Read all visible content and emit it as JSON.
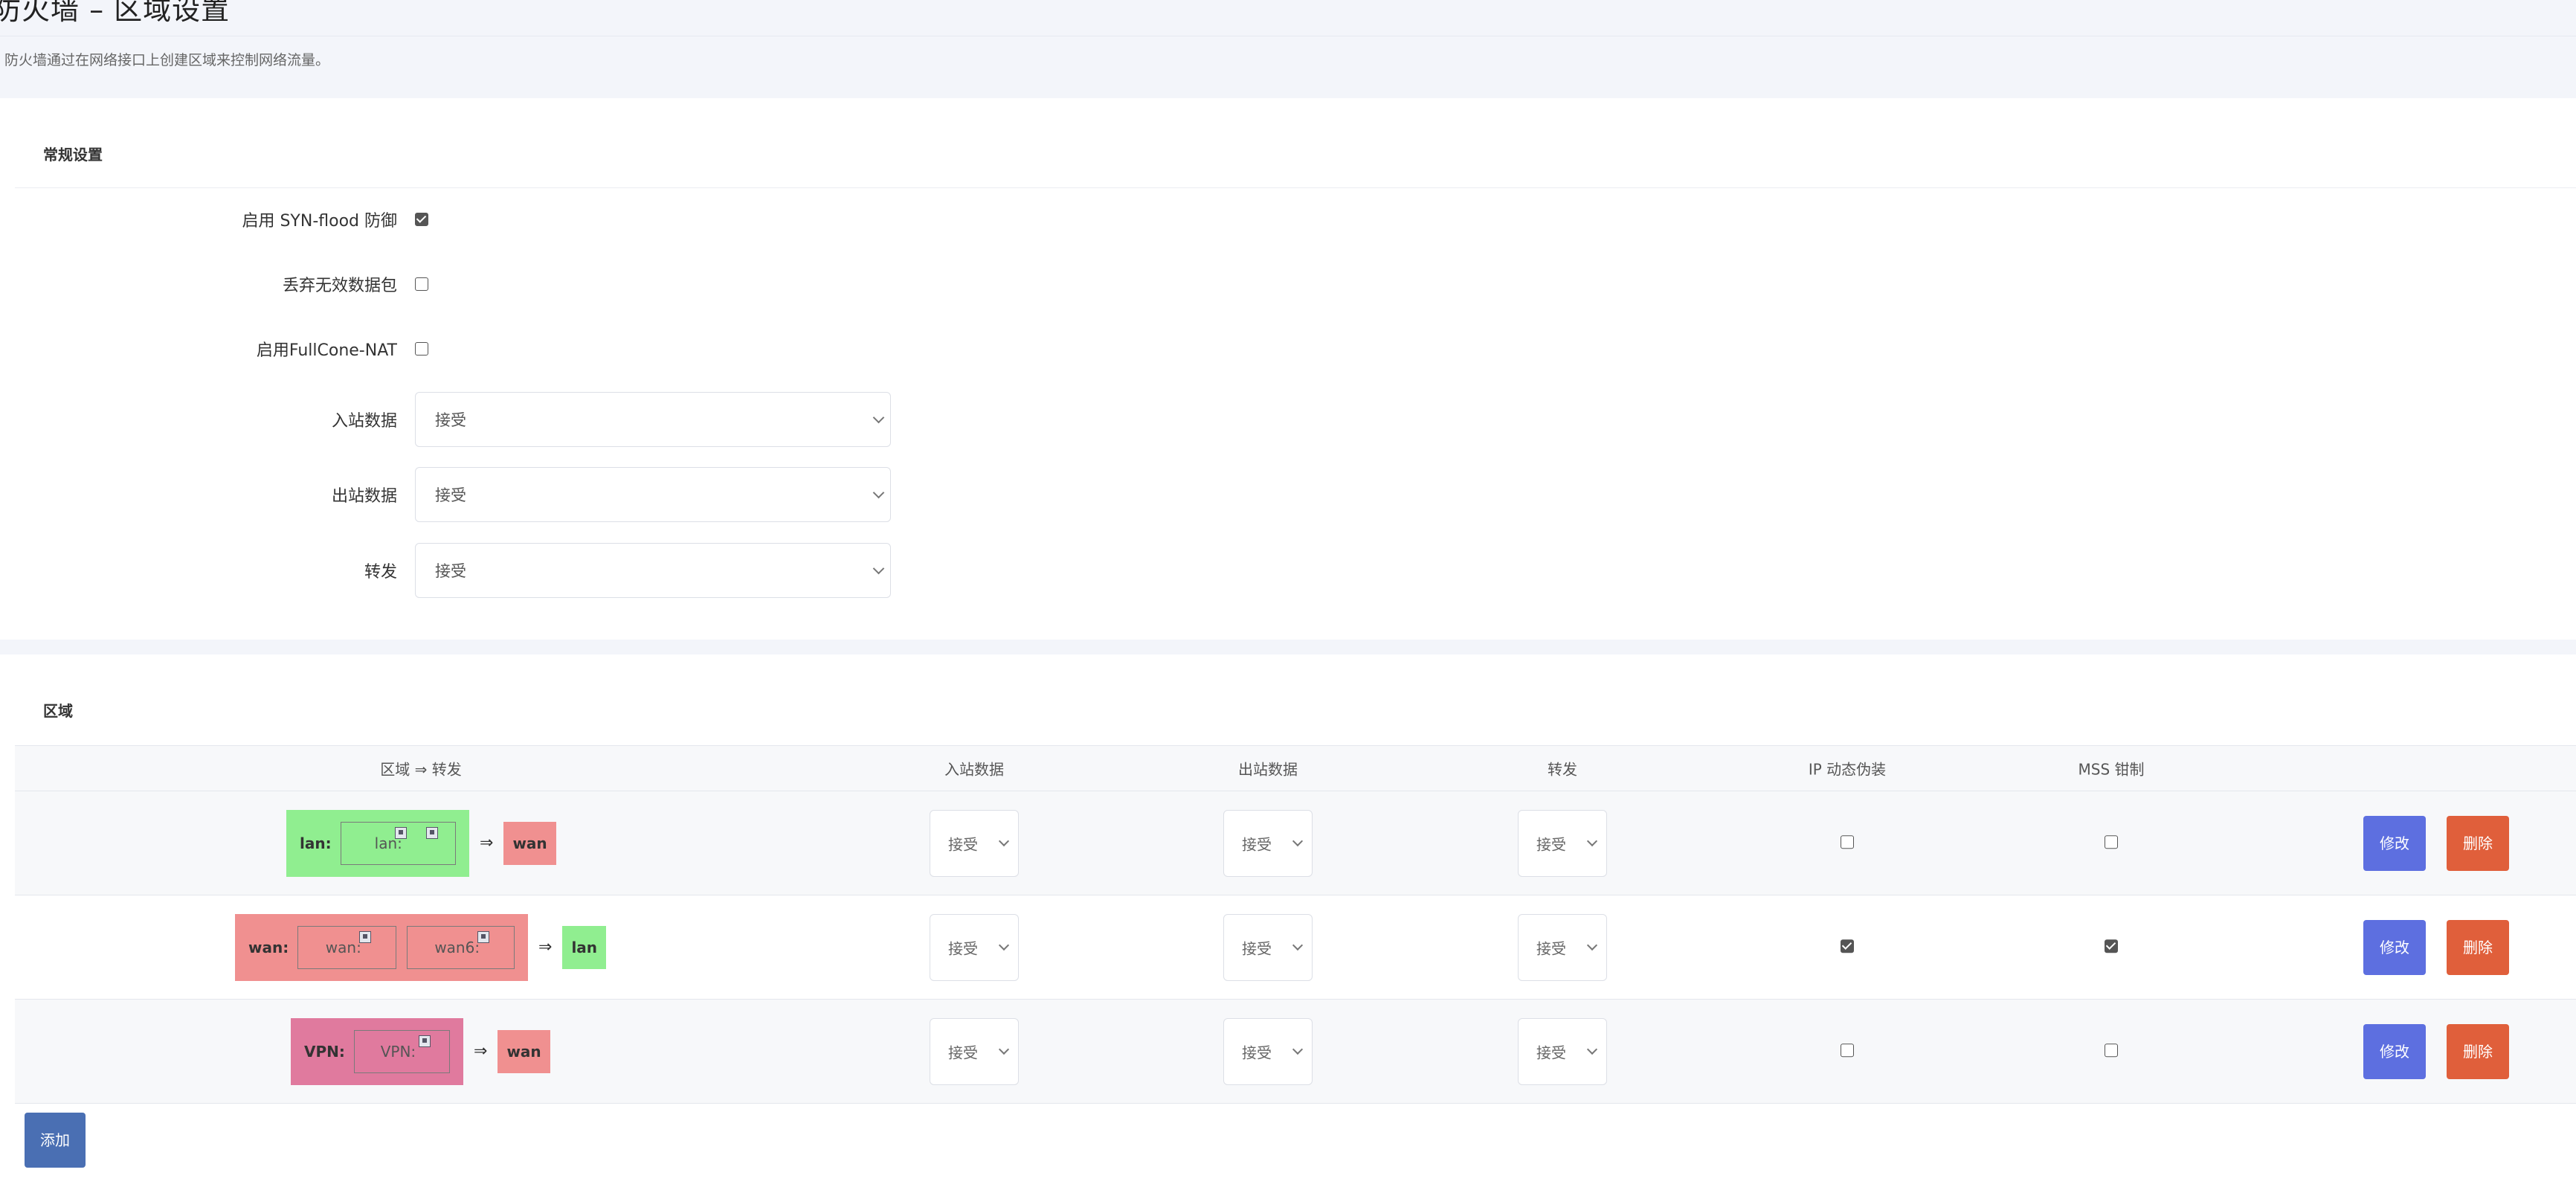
{
  "header": {
    "title": "防火墙 – 区域设置",
    "description": "防火墙通过在网络接口上创建区域来控制网络流量。"
  },
  "general": {
    "title": "常规设置",
    "syn_flood": {
      "label": "启用 SYN-flood 防御",
      "checked": true
    },
    "drop_invalid": {
      "label": "丢弃无效数据包",
      "checked": false
    },
    "fullcone": {
      "label": "启用FullCone-NAT",
      "checked": false
    },
    "input": {
      "label": "入站数据",
      "value": "接受"
    },
    "output": {
      "label": "出站数据",
      "value": "接受"
    },
    "forward": {
      "label": "转发",
      "value": "接受"
    }
  },
  "zones": {
    "title": "区域",
    "columns": {
      "zone": "区域 ⇒ 转发",
      "input": "入站数据",
      "output": "出站数据",
      "forward": "转发",
      "masq": "IP 动态伪装",
      "mss": "MSS 钳制"
    },
    "arrow": "⇒",
    "rows": [
      {
        "name": "lan:",
        "zone_color": "#90ee90",
        "interfaces": [
          "lan:"
        ],
        "dest": "wan",
        "dest_color": "#f09090",
        "input": "接受",
        "output": "接受",
        "forward": "接受",
        "masq": false,
        "mss": false
      },
      {
        "name": "wan:",
        "zone_color": "#f09090",
        "interfaces": [
          "wan:",
          "wan6:"
        ],
        "dest": "lan",
        "dest_color": "#90ee90",
        "input": "接受",
        "output": "接受",
        "forward": "接受",
        "masq": true,
        "mss": true
      },
      {
        "name": "VPN:",
        "zone_color": "#e07a9e",
        "interfaces": [
          "VPN:"
        ],
        "dest": "wan",
        "dest_color": "#f09090",
        "input": "接受",
        "output": "接受",
        "forward": "接受",
        "masq": false,
        "mss": false
      }
    ],
    "edit_label": "修改",
    "delete_label": "删除",
    "add_label": "添加"
  },
  "icons": [
    "network-port-icon",
    "chevron-down-icon"
  ]
}
